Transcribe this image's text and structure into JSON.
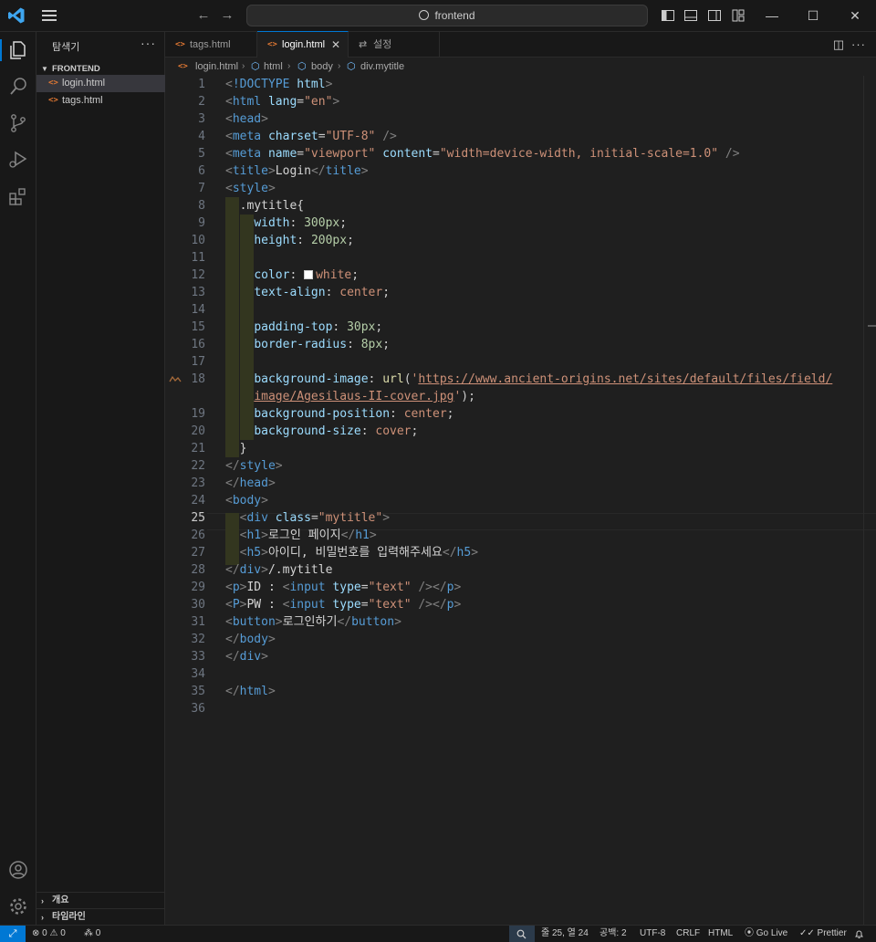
{
  "titlebar": {
    "search_text": "frontend",
    "logo_icon": "vscode-logo-icon",
    "accent": "#0078d4"
  },
  "sidebar": {
    "title": "탐색기",
    "more": "···",
    "folder": "FRONTEND",
    "files": [
      {
        "name": "login.html",
        "active": true
      },
      {
        "name": "tags.html",
        "active": false
      }
    ],
    "sections": [
      "개요",
      "타임라인"
    ]
  },
  "tabs": [
    {
      "label": "tags.html",
      "active": false
    },
    {
      "label": "login.html",
      "active": true
    },
    {
      "label": "설정",
      "active": false
    }
  ],
  "breadcrumb": [
    "login.html",
    "html",
    "body",
    "div.mytitle"
  ],
  "editor": {
    "current_line": 25,
    "lines": [
      {
        "n": "1",
        "code": "<!DOCTYPE html>"
      },
      {
        "n": "2",
        "code": "<html lang=\"en\">"
      },
      {
        "n": "3",
        "code": "<head>"
      },
      {
        "n": "4",
        "code": "<meta charset=\"UTF-8\" />"
      },
      {
        "n": "5",
        "code": "<meta name=\"viewport\" content=\"width=device-width, initial-scale=1.0\" />"
      },
      {
        "n": "6",
        "code": "<title>Login</title>"
      },
      {
        "n": "7",
        "code": "<style>"
      },
      {
        "n": "8",
        "code": "  .mytitle{"
      },
      {
        "n": "9",
        "code": "    width: 300px;"
      },
      {
        "n": "10",
        "code": "    height: 200px;"
      },
      {
        "n": "11",
        "code": ""
      },
      {
        "n": "12",
        "code": "    color: white;"
      },
      {
        "n": "13",
        "code": "    text-align: center;"
      },
      {
        "n": "14",
        "code": ""
      },
      {
        "n": "15",
        "code": "    padding-top: 30px;"
      },
      {
        "n": "16",
        "code": "    border-radius: 8px;"
      },
      {
        "n": "17",
        "code": ""
      },
      {
        "n": "18",
        "code": "    background-image: url('https://www.ancient-origins.net/sites/default/files/field/"
      },
      {
        "n": "",
        "code": "    image/Agesilaus-II-cover.jpg');"
      },
      {
        "n": "19",
        "code": "    background-position: center;"
      },
      {
        "n": "20",
        "code": "    background-size: cover;"
      },
      {
        "n": "21",
        "code": "  }"
      },
      {
        "n": "22",
        "code": "</style>"
      },
      {
        "n": "23",
        "code": "</head>"
      },
      {
        "n": "24",
        "code": "<body>"
      },
      {
        "n": "25",
        "code": "  <div class=\"mytitle\">"
      },
      {
        "n": "26",
        "code": "  <h1>로그인 페이지</h1>"
      },
      {
        "n": "27",
        "code": "  <h5>아이디, 비밀번호를 입력해주세요</h5>"
      },
      {
        "n": "28",
        "code": "</div>/.mytitle"
      },
      {
        "n": "29",
        "code": "<p>ID : <input type=\"text\" /></p>"
      },
      {
        "n": "30",
        "code": "<P>PW : <input type=\"text\" /></p>"
      },
      {
        "n": "31",
        "code": "<button>로그인하기</button>"
      },
      {
        "n": "32",
        "code": "</body>"
      },
      {
        "n": "33",
        "code": "</div>"
      },
      {
        "n": "34",
        "code": ""
      },
      {
        "n": "35",
        "code": "</html>"
      },
      {
        "n": "36",
        "code": ""
      }
    ]
  },
  "statusbar": {
    "errors": "0",
    "warnings": "0",
    "ports": "0",
    "position": "줄 25, 열 24",
    "spaces": "공백: 2",
    "encoding": "UTF-8",
    "eol": "CRLF",
    "language": "HTML",
    "golive": "Go Live",
    "prettier": "Prettier"
  }
}
